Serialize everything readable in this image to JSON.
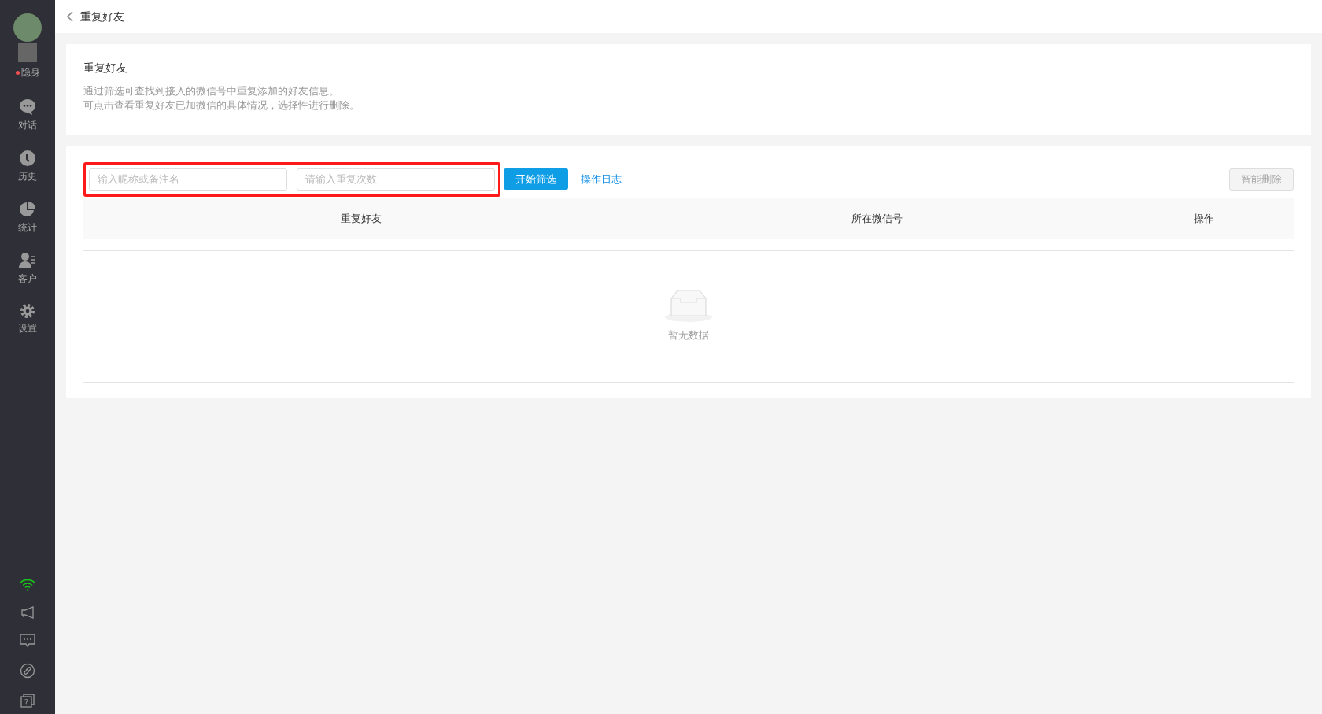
{
  "sidebar": {
    "status": {
      "label": "隐身",
      "color": "#f05050"
    },
    "items": [
      {
        "kind": "chat",
        "label": "对话"
      },
      {
        "kind": "history",
        "label": "历史"
      },
      {
        "kind": "stats",
        "label": "统计"
      },
      {
        "kind": "customer",
        "label": "客户"
      },
      {
        "kind": "settings",
        "label": "设置"
      }
    ],
    "bottom_icons": [
      {
        "kind": "wifi"
      },
      {
        "kind": "megaphone"
      },
      {
        "kind": "message"
      },
      {
        "kind": "link"
      },
      {
        "kind": "help",
        "glyph": "?"
      }
    ]
  },
  "header": {
    "title": "重复好友"
  },
  "intro": {
    "title": "重复好友",
    "lines": [
      "通过筛选可查找到接入的微信号中重复添加的好友信息。",
      "可点击查看重复好友已加微信的具体情况，选择性进行删除。"
    ]
  },
  "filter": {
    "fields": [
      {
        "placeholder": "输入昵称或备注名"
      },
      {
        "placeholder": "请输入重复次数"
      }
    ],
    "search_button": "开始筛选",
    "log_link": "操作日志",
    "delete_button": {
      "label": "智能删除",
      "disabled": true
    }
  },
  "table": {
    "columns": [
      "重复好友",
      "所在微信号",
      "操作"
    ],
    "empty_text": "暂无数据"
  }
}
